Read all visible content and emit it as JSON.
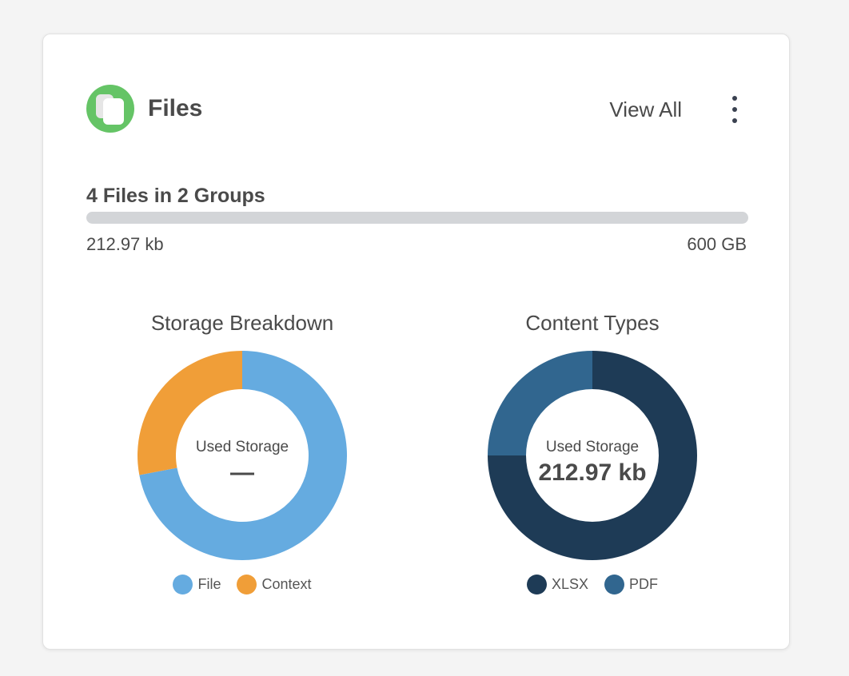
{
  "card": {
    "title": "Files",
    "view_all_label": "View All",
    "icon": "files-icon",
    "more_icon": "more-vertical-icon"
  },
  "summary": {
    "text": "4 Files in 2 Groups",
    "used_label": "212.97 kb",
    "capacity_label": "600 GB",
    "used_fraction": 0.0
  },
  "colors": {
    "brand_green": "#65c466",
    "file": "#65abe0",
    "context": "#f09e38",
    "xlsx": "#1e3b56",
    "pdf": "#31668f",
    "track": "#d3d5d8"
  },
  "chart_data": [
    {
      "type": "pie",
      "title": "Storage Breakdown",
      "center_caption": "Used Storage",
      "center_value": "—",
      "categories": [
        "File",
        "Context"
      ],
      "values": [
        72,
        28
      ],
      "colors": [
        "#65abe0",
        "#f09e38"
      ]
    },
    {
      "type": "pie",
      "title": "Content Types",
      "center_caption": "Used Storage",
      "center_value": "212.97 kb",
      "categories": [
        "XLSX",
        "PDF"
      ],
      "values": [
        75,
        25
      ],
      "colors": [
        "#1e3b56",
        "#31668f"
      ]
    }
  ]
}
